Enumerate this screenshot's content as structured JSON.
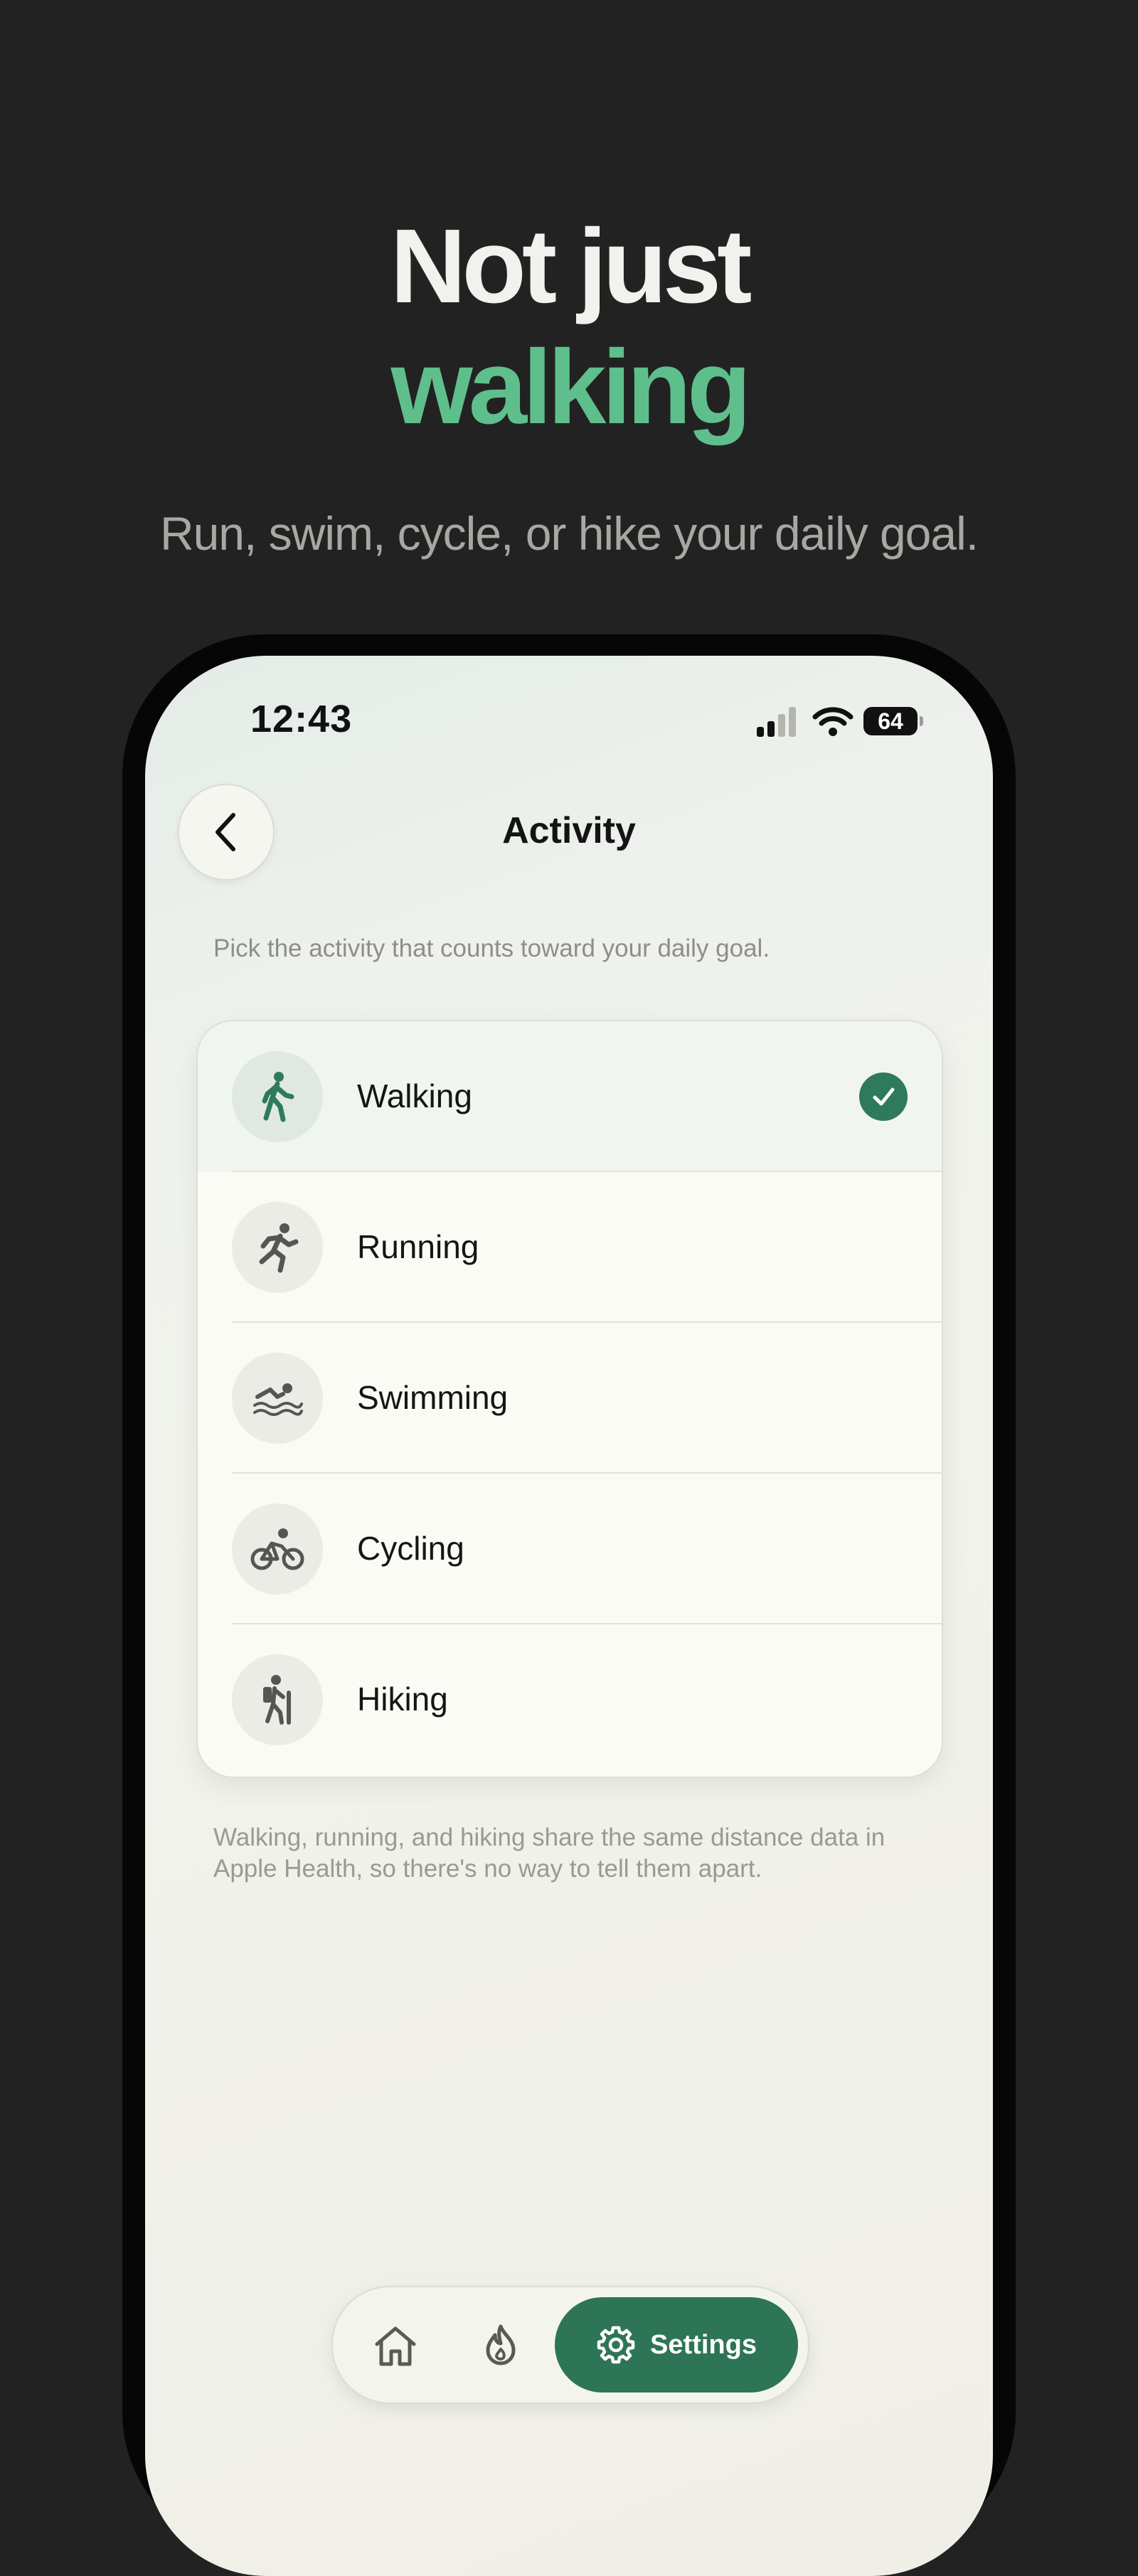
{
  "hero": {
    "title_line1": "Not just",
    "title_line2": "walking",
    "subtitle": "Run, swim, cycle, or hike your daily goal."
  },
  "status_bar": {
    "time": "12:43",
    "battery": "64"
  },
  "nav": {
    "title": "Activity",
    "back_icon": "chevron-left-icon"
  },
  "intro": "Pick the activity that counts toward your daily goal.",
  "activities": [
    {
      "label": "Walking",
      "icon": "walking-icon",
      "selected": true
    },
    {
      "label": "Running",
      "icon": "running-icon",
      "selected": false
    },
    {
      "label": "Swimming",
      "icon": "swimming-icon",
      "selected": false
    },
    {
      "label": "Cycling",
      "icon": "cycling-icon",
      "selected": false
    },
    {
      "label": "Hiking",
      "icon": "hiking-icon",
      "selected": false
    }
  ],
  "footnote": "Walking, running, and hiking share the same distance data in Apple Health, so there's no way to tell them apart.",
  "tabbar": {
    "home_icon": "home-icon",
    "streak_icon": "flame-icon",
    "settings_label": "Settings",
    "settings_icon": "gear-icon"
  },
  "colors": {
    "background": "#222222",
    "accent_green": "#5fbf8c",
    "button_green": "#2d7556",
    "check_green": "#2f7a5c"
  }
}
